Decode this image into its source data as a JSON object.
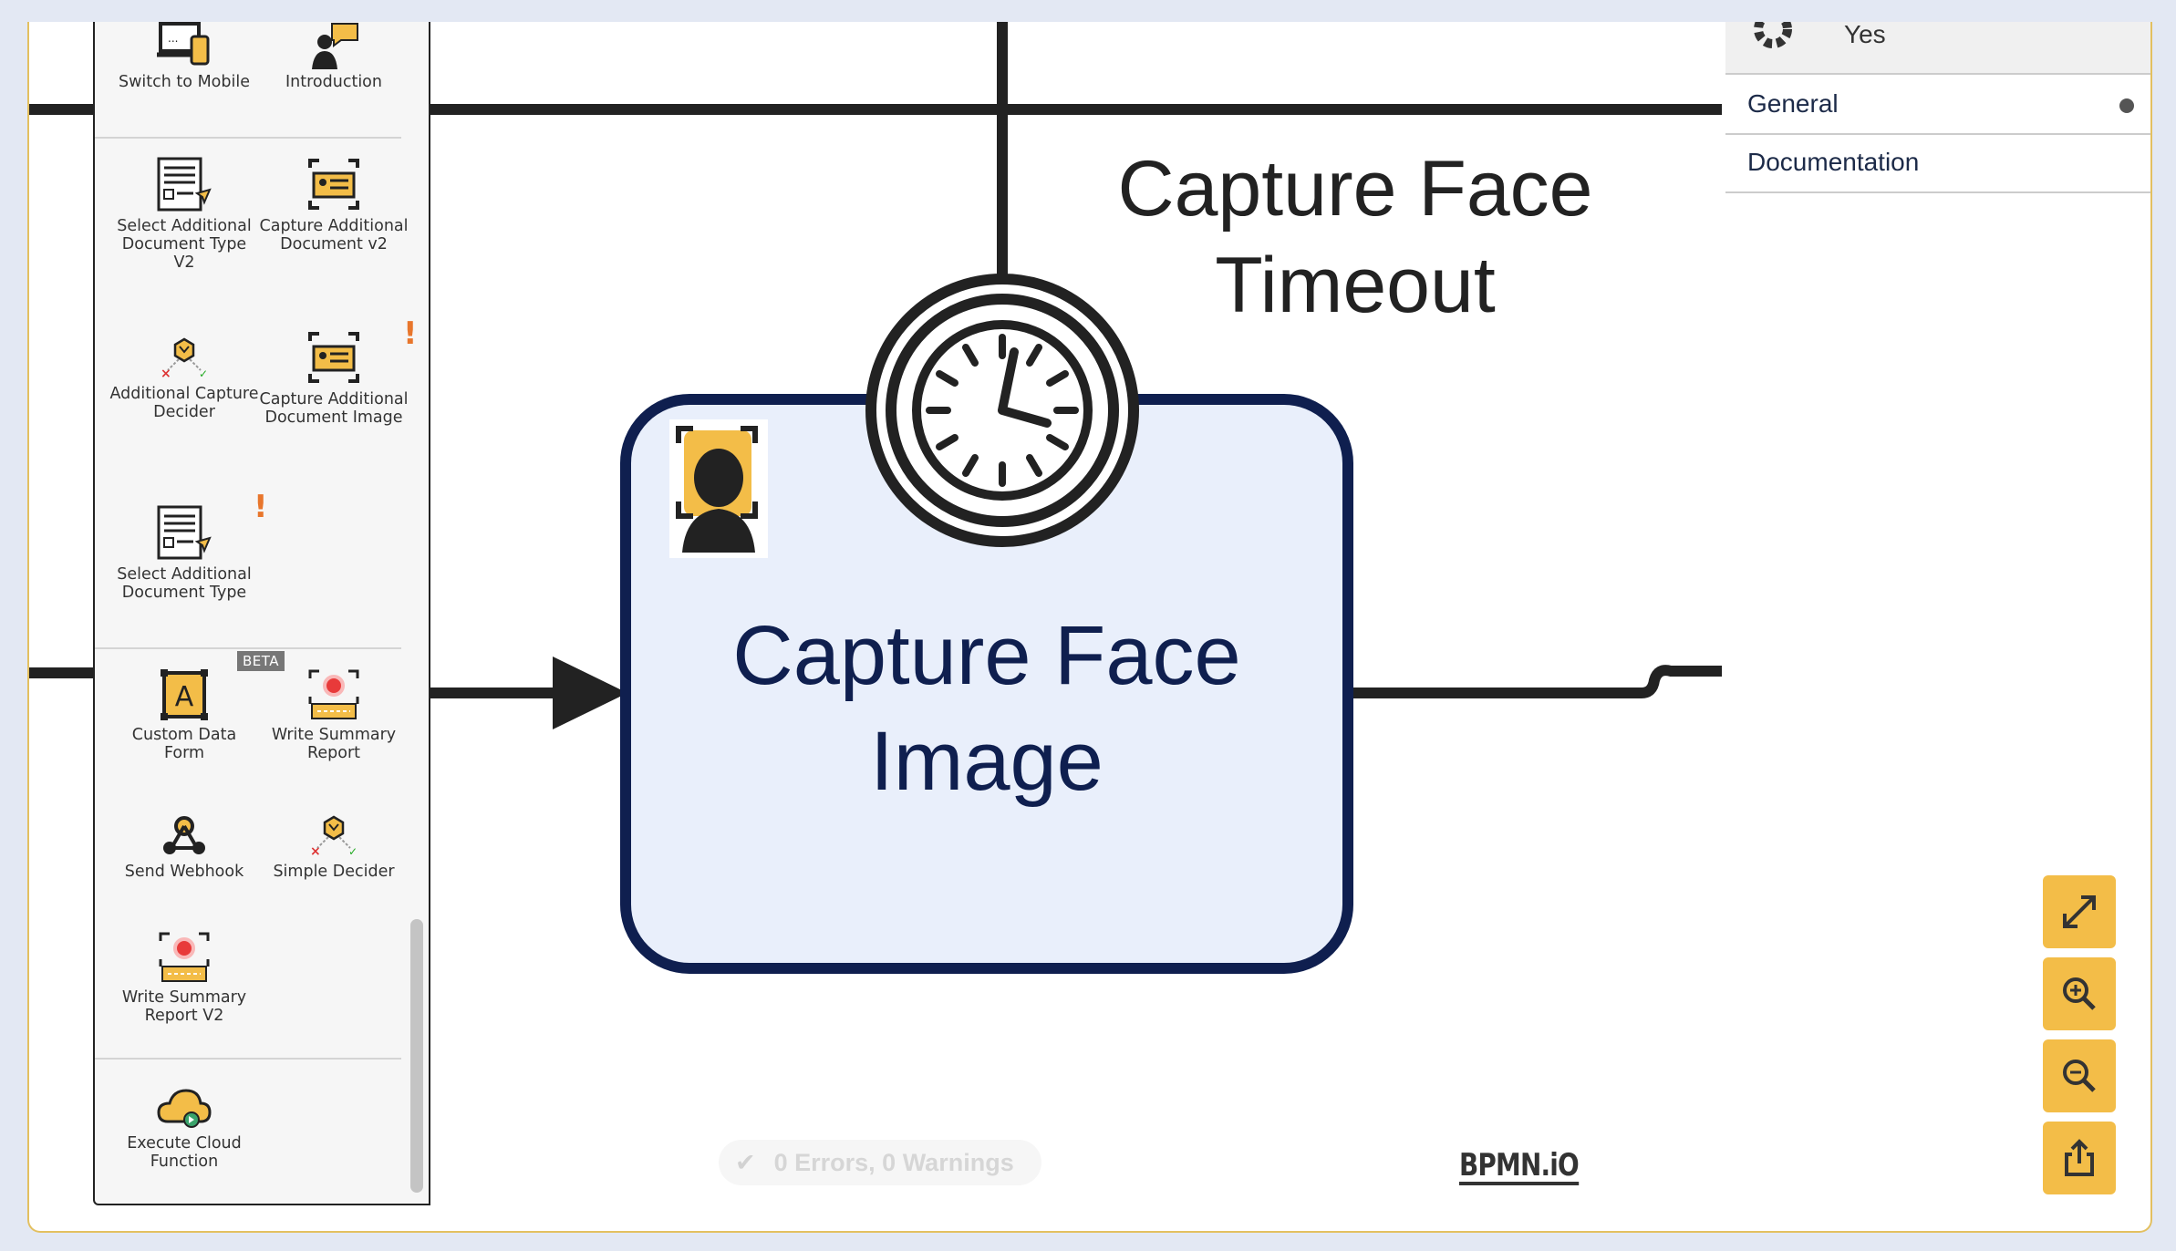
{
  "palette": {
    "items": [
      {
        "label": "Switch to Mobile",
        "icon": "laptop-mobile-icon"
      },
      {
        "label": "Introduction",
        "icon": "person-speech-icon"
      },
      {
        "label": "Select Additional Document Type V2",
        "icon": "document-select-icon"
      },
      {
        "label": "Capture Additional Document v2",
        "icon": "id-card-capture-icon"
      },
      {
        "label": "Additional Capture Decider",
        "icon": "decider-icon"
      },
      {
        "label": "Capture Additional Document Image",
        "icon": "id-card-capture-icon"
      },
      {
        "label": "Select Additional Document Type",
        "icon": "document-select-icon"
      },
      {
        "label": "Custom Data Form",
        "icon": "custom-form-icon"
      },
      {
        "label": "Write Summary Report",
        "icon": "summary-report-icon"
      },
      {
        "label": "Send Webhook",
        "icon": "webhook-icon"
      },
      {
        "label": "Simple Decider",
        "icon": "decider-icon"
      },
      {
        "label": "Write Summary Report V2",
        "icon": "summary-report-icon"
      },
      {
        "label": "Execute Cloud Function",
        "icon": "cloud-function-icon"
      }
    ],
    "beta_badge": "BETA",
    "warning_mark": "!"
  },
  "diagram": {
    "task_label_line1": "Capture Face",
    "task_label_line2": "Image",
    "timer_label_line1": "Capture Face",
    "timer_label_line2": "Timeout",
    "colors": {
      "task_fill": "#e9effb",
      "task_stroke": "#0f1f4f",
      "flow": "#222222"
    }
  },
  "properties": {
    "header_value": "Yes",
    "groups": [
      "General",
      "Documentation"
    ]
  },
  "status": "0 Errors, 0 Warnings",
  "logo": "BPMN.iO",
  "controls": [
    "fit-to-screen-icon",
    "zoom-in-icon",
    "zoom-out-icon",
    "export-icon"
  ],
  "accent": "#f3bd48"
}
